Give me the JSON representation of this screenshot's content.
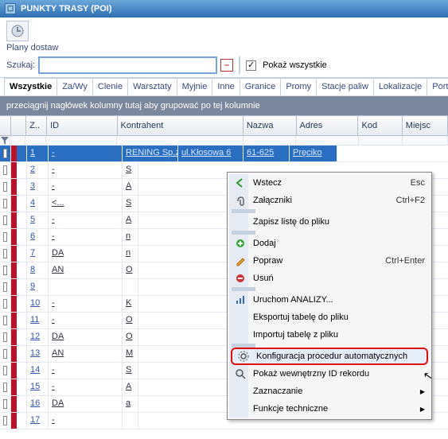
{
  "window": {
    "title": "PUNKTY TRASY (POI)"
  },
  "toolbar": {
    "plany_label": "Plany dostaw"
  },
  "search": {
    "label": "Szukaj:",
    "value": "",
    "show_all": "Pokaż wszystkie"
  },
  "tabs": [
    "Wszystkie",
    "Za/Wy",
    "Clenie",
    "Warsztaty",
    "Myjnie",
    "Inne",
    "Granice",
    "Promy",
    "Stacje paliw",
    "Lokalizacje",
    "Port"
  ],
  "active_tab": 0,
  "group_bar": "przeciągnij nagłówek kolumny tutaj aby grupować po tej kolumnie",
  "columns": [
    "",
    "Z..",
    "ID",
    "Kontrahent",
    "Nazwa",
    "Adres",
    "Kod",
    "Miejsc"
  ],
  "rows": [
    {
      "id": "1",
      "kontr": "-",
      "nazwa": "RENING Sp.z ...",
      "adres": "ul.Kłosowa 6",
      "kod": "61-625",
      "miejsc": "Pręciko",
      "sel": true
    },
    {
      "id": "2",
      "kontr": "-",
      "nazwa": "S"
    },
    {
      "id": "3",
      "kontr": "-",
      "nazwa": "A"
    },
    {
      "id": "4",
      "kontr": "<...",
      "nazwa": "S"
    },
    {
      "id": "5",
      "kontr": "-",
      "nazwa": "A"
    },
    {
      "id": "6",
      "kontr": "-",
      "nazwa": "n"
    },
    {
      "id": "7",
      "kontr": "DA",
      "nazwa": "n"
    },
    {
      "id": "8",
      "kontr": "AN",
      "nazwa": "O"
    },
    {
      "id": "9",
      "kontr": "",
      "nazwa": ""
    },
    {
      "id": "10",
      "kontr": "-",
      "nazwa": "K"
    },
    {
      "id": "11",
      "kontr": "-",
      "nazwa": "O"
    },
    {
      "id": "12",
      "kontr": "DA",
      "nazwa": "O"
    },
    {
      "id": "13",
      "kontr": "AN",
      "nazwa": "M"
    },
    {
      "id": "14",
      "kontr": "-",
      "nazwa": "S"
    },
    {
      "id": "15",
      "kontr": "-",
      "nazwa": "A"
    },
    {
      "id": "16",
      "kontr": "DA",
      "nazwa": "a"
    },
    {
      "id": "17",
      "kontr": "-",
      "nazwa": ""
    }
  ],
  "menu": {
    "items": [
      {
        "icon": "back",
        "label": "Wstecz",
        "shortcut": "Esc"
      },
      {
        "icon": "attach",
        "label": "Załączniki",
        "shortcut": "Ctrl+F2"
      },
      {
        "sep": true
      },
      {
        "icon": "",
        "label": "Zapisz listę do pliku"
      },
      {
        "sep": true
      },
      {
        "icon": "plus",
        "label": "Dodaj"
      },
      {
        "icon": "edit",
        "label": "Popraw",
        "shortcut": "Ctrl+Enter"
      },
      {
        "icon": "minus",
        "label": "Usuń"
      },
      {
        "sep": true
      },
      {
        "icon": "chart",
        "label": "Uruchom ANALIZY..."
      },
      {
        "icon": "",
        "label": "Eksportuj tabelę do pliku"
      },
      {
        "icon": "",
        "label": "Importuj tabelę z pliku"
      },
      {
        "sep": true
      },
      {
        "icon": "gear",
        "label": "Konfiguracja procedur automatycznych",
        "hl": true
      },
      {
        "icon": "zoom",
        "label": "Pokaż wewnętrzny ID rekordu"
      },
      {
        "icon": "",
        "label": "Zaznaczanie",
        "arrow": true
      },
      {
        "icon": "",
        "label": "Funkcje techniczne",
        "arrow": true
      }
    ]
  }
}
